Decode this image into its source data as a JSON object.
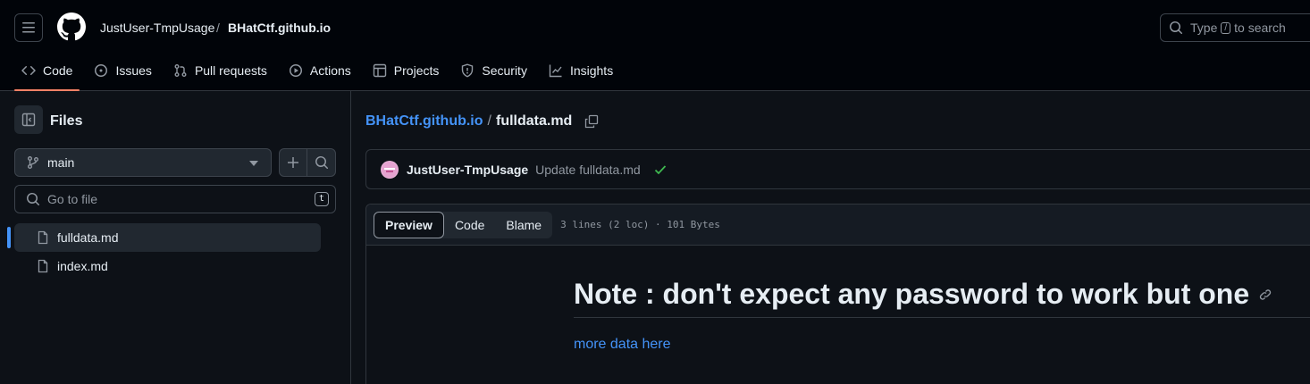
{
  "header": {
    "owner": "JustUser-TmpUsage",
    "separator": "/",
    "repo": "BHatCtf.github.io",
    "search": {
      "prefix": "Type",
      "key": "/",
      "suffix": "to search"
    }
  },
  "nav": [
    {
      "label": "Code",
      "icon": "code-icon",
      "active": true
    },
    {
      "label": "Issues",
      "icon": "issue-icon"
    },
    {
      "label": "Pull requests",
      "icon": "pull-request-icon"
    },
    {
      "label": "Actions",
      "icon": "play-icon"
    },
    {
      "label": "Projects",
      "icon": "table-icon"
    },
    {
      "label": "Security",
      "icon": "shield-icon"
    },
    {
      "label": "Insights",
      "icon": "graph-icon"
    }
  ],
  "sidebar": {
    "title": "Files",
    "branch": "main",
    "goto_placeholder": "Go to file",
    "goto_shortcut": "t",
    "files": [
      {
        "name": "fulldata.md",
        "selected": true
      },
      {
        "name": "index.md",
        "selected": false
      }
    ]
  },
  "main": {
    "path_repo": "BHatCtf.github.io",
    "path_sep": "/",
    "path_file": "fulldata.md",
    "commit": {
      "author": "JustUser-TmpUsage",
      "message": "Update fulldata.md",
      "status": "success"
    },
    "tabs": [
      "Preview",
      "Code",
      "Blame"
    ],
    "active_tab": "Preview",
    "file_info": "3 lines (2 loc) · 101 Bytes",
    "heading": "Note : don't expect any password to work but one",
    "link_text": "more data here"
  },
  "colors": {
    "accent": "#4493f8",
    "nav_underline": "#f78166",
    "success": "#3fb950"
  }
}
